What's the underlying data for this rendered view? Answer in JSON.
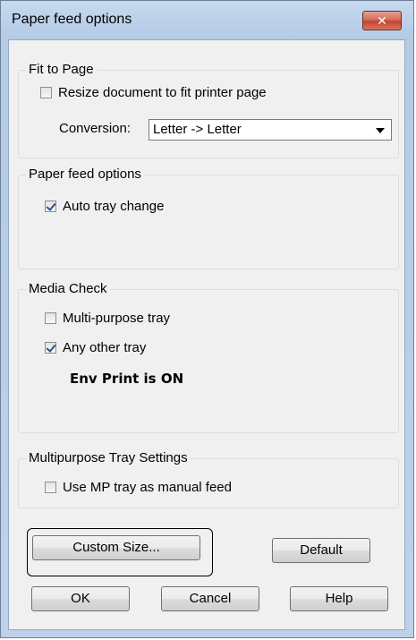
{
  "dialog": {
    "title": "Paper feed options",
    "close_label": "✕"
  },
  "fit_to_page": {
    "label": "Fit to Page",
    "resize_checkbox": {
      "label": "Resize document to fit printer page",
      "checked": false
    },
    "conversion_label": "Conversion:",
    "conversion_value": "Letter -> Letter"
  },
  "paper_feed": {
    "label": "Paper feed options",
    "auto_tray_change": {
      "label": "Auto tray change",
      "checked": true
    }
  },
  "media_check": {
    "label": "Media Check",
    "multi_purpose_tray": {
      "label": "Multi-purpose tray",
      "checked": false
    },
    "any_other_tray": {
      "label": "Any other tray",
      "checked": true
    },
    "status": "Env Print is ON"
  },
  "mp_tray": {
    "label": "Multipurpose Tray Settings",
    "manual_feed": {
      "label": "Use MP tray as manual feed",
      "checked": false
    }
  },
  "buttons": {
    "custom_size": "Custom Size...",
    "default": "Default",
    "ok": "OK",
    "cancel": "Cancel",
    "help": "Help"
  },
  "colors": {
    "titlebar": "#bdd2ea",
    "close_button": "#c24431",
    "client_background": "#f0f0f0"
  }
}
